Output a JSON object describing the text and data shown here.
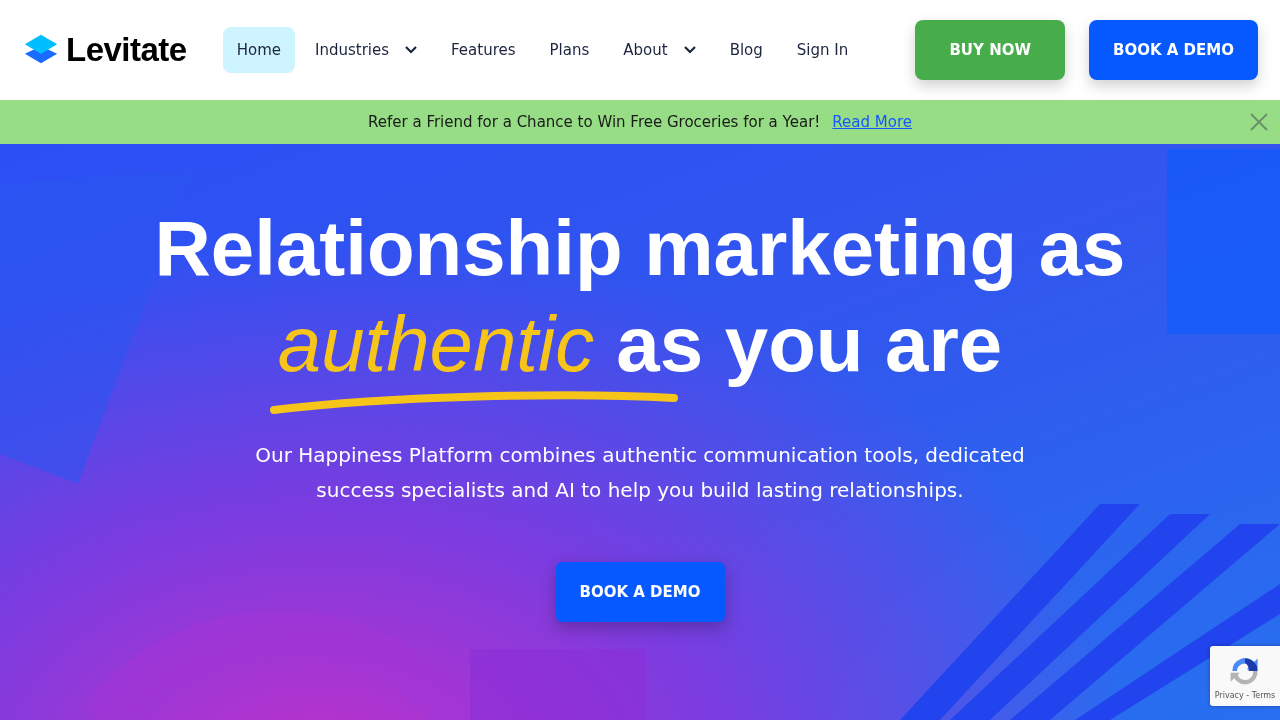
{
  "header": {
    "logo": "Levitate",
    "nav": [
      {
        "label": "Home",
        "selected": true,
        "dropdown": false
      },
      {
        "label": "Industries",
        "selected": false,
        "dropdown": true
      },
      {
        "label": "Features",
        "selected": false,
        "dropdown": false
      },
      {
        "label": "Plans",
        "selected": false,
        "dropdown": false
      },
      {
        "label": "About",
        "selected": false,
        "dropdown": true
      },
      {
        "label": "Blog",
        "selected": false,
        "dropdown": false
      },
      {
        "label": "Sign In",
        "selected": false,
        "dropdown": false
      }
    ],
    "buttons": [
      {
        "label": "BUY NOW",
        "kind": "buy"
      },
      {
        "label": "BOOK A DEMO",
        "kind": "demo"
      }
    ]
  },
  "announcement": {
    "text": "Refer a Friend for a Chance to Win Free Groceries for a Year!",
    "link": "Read More"
  },
  "hero": {
    "headline_line1": "Relationship marketing as",
    "highlight": "authentic",
    "headline_rest": "as you are",
    "subtitle": "Our Happiness Platform combines authentic communication tools, dedicated success specialists and AI to help you build lasting relationships.",
    "button": "BOOK A DEMO"
  },
  "recaptcha": {
    "links": "Privacy - Terms"
  }
}
